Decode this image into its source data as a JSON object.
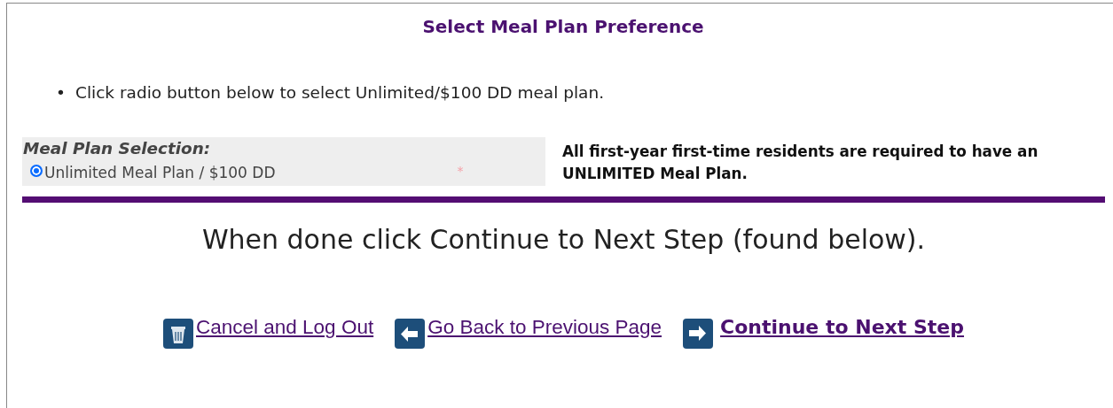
{
  "title": "Select Meal Plan Preference",
  "instructions": [
    {
      "marker": "•",
      "text": "Click radio button below to select Unlimited/$100 DD meal plan."
    }
  ],
  "selection": {
    "heading": "Meal Plan Selection:",
    "options": [
      {
        "label": "Unlimited Meal Plan / $100 DD",
        "selected": true
      }
    ],
    "required_mark": "*"
  },
  "note": "All first-year first-time residents are required to have an UNLIMITED Meal Plan.",
  "done_message": "When done click Continue to Next Step (found below).",
  "links": [
    {
      "label": "Cancel and Log Out",
      "kind": "trash",
      "bold": false
    },
    {
      "label": "Go Back to Previous Page",
      "kind": "back",
      "bold": false
    },
    {
      "label": "Continue to Next Step",
      "kind": "forward",
      "bold": true
    }
  ]
}
